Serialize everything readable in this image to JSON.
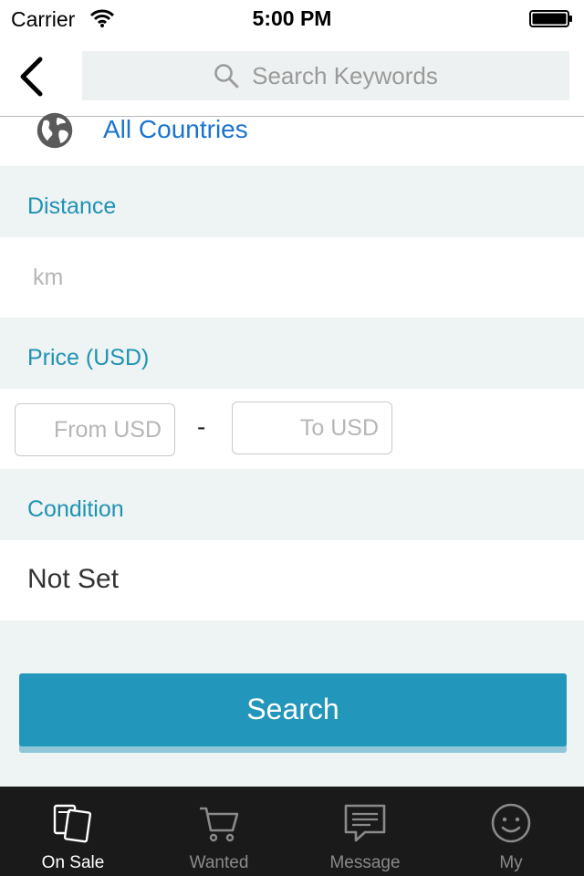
{
  "status_bar": {
    "carrier": "Carrier",
    "time": "5:00 PM"
  },
  "nav": {
    "search_placeholder": "Search Keywords"
  },
  "location": {
    "label": "All Countries"
  },
  "distance": {
    "header": "Distance",
    "placeholder": "km"
  },
  "price": {
    "header": "Price (USD)",
    "from_placeholder": "From USD",
    "separator": "-",
    "to_placeholder": "To USD"
  },
  "condition": {
    "header": "Condition",
    "value": "Not Set"
  },
  "search_button": {
    "label": "Search"
  },
  "tabs": [
    {
      "label": "On Sale",
      "icon": "cards-icon",
      "active": true
    },
    {
      "label": "Wanted",
      "icon": "cart-icon",
      "active": false
    },
    {
      "label": "Message",
      "icon": "message-icon",
      "active": false
    },
    {
      "label": "My",
      "icon": "smiley-icon",
      "active": false
    }
  ],
  "colors": {
    "accent": "#2397bb",
    "section_text": "#1f93b4",
    "link": "#1a74cf",
    "tab_bar": "#1a1a1a"
  }
}
